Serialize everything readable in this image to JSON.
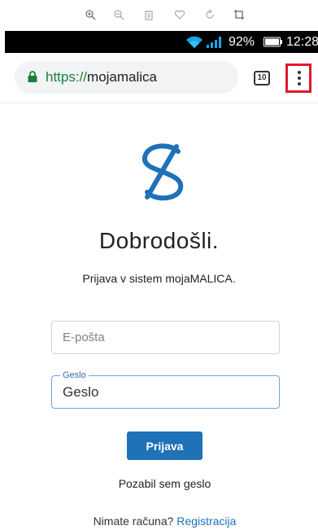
{
  "viewer_toolbar": {
    "icons": [
      "zoom-in-icon",
      "zoom-out-icon",
      "delete-icon",
      "favorite-icon",
      "rotate-icon",
      "crop-icon"
    ]
  },
  "status_bar": {
    "battery": "92%",
    "time": "12:28",
    "icons": [
      "wifi-icon",
      "signal-icon",
      "battery-icon"
    ]
  },
  "browser": {
    "url_scheme": "https://",
    "url_host": "mojamalica",
    "tab_count": "10",
    "menu_icon": "more-vert-icon",
    "highlight_color": "#e0192b"
  },
  "page": {
    "title": "Dobrodošli.",
    "subtitle": "Prijava v sistem mojaMALICA.",
    "email_placeholder": "E-pošta",
    "password_label": "Geslo",
    "password_value": "Geslo",
    "login_button": "Prijava",
    "forgot_password": "Pozabil sem geslo",
    "no_account_text": "Nimate računa? ",
    "register_link": "Registracija",
    "accent_color": "#1f71b8"
  }
}
